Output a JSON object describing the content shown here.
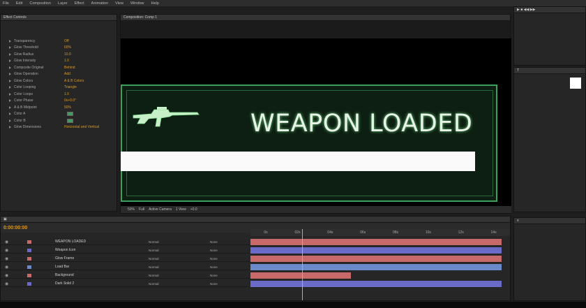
{
  "menubar": [
    "File",
    "Edit",
    "Composition",
    "Layer",
    "Effect",
    "Animation",
    "View",
    "Window",
    "Help"
  ],
  "effects_panel": {
    "tab": "Effect Controls",
    "rows": [
      {
        "label": "Transparency",
        "value": "Off"
      },
      {
        "label": "Glow Threshold",
        "value": "60%"
      },
      {
        "label": "Glow Radius",
        "value": "10.0"
      },
      {
        "label": "Glow Intensity",
        "value": "1.0"
      },
      {
        "label": "Composite Original",
        "value": "Behind"
      },
      {
        "label": "Glow Operation",
        "value": "Add"
      },
      {
        "label": "Glow Colors",
        "value": "A & B Colors"
      },
      {
        "label": "Color Looping",
        "value": "Triangle"
      },
      {
        "label": "Color Loops",
        "value": "1.0"
      },
      {
        "label": "Color Phase",
        "value": "0x+0.0°"
      },
      {
        "label": "A & B Midpoint",
        "value": "50%"
      },
      {
        "label": "Color A",
        "value": ""
      },
      {
        "label": "Color B",
        "value": ""
      },
      {
        "label": "Glow Dimensions",
        "value": "Horizontal and Vertical"
      }
    ]
  },
  "composition": {
    "tab": "Composition: Comp 1",
    "title": "WEAPON LOADED",
    "footer": [
      "50%",
      "Full",
      "Active Camera",
      "1 View",
      "+0.0"
    ]
  },
  "timeline": {
    "timecode": "0:00:00:00",
    "ruler": [
      "0s",
      "02s",
      "04s",
      "06s",
      "08s",
      "10s",
      "12s",
      "14s"
    ],
    "layers": [
      {
        "name": "WEAPON LOADED",
        "mode": "Normal",
        "parent": "None",
        "color": "#c96a6a"
      },
      {
        "name": "Weapon Icon",
        "mode": "Normal",
        "parent": "None",
        "color": "#6a6ac9"
      },
      {
        "name": "Glow Frame",
        "mode": "Normal",
        "parent": "None",
        "color": "#c96a6a"
      },
      {
        "name": "Load Bar",
        "mode": "Normal",
        "parent": "None",
        "color": "#6a8ac9"
      },
      {
        "name": "Background",
        "mode": "Normal",
        "parent": "None",
        "color": "#c96a6a"
      },
      {
        "name": "Dark Solid 2",
        "mode": "Normal",
        "parent": "None",
        "color": "#6a6ac9"
      }
    ]
  },
  "colors": {
    "accent": "#d89a2a",
    "glow": "#3aa05a"
  }
}
